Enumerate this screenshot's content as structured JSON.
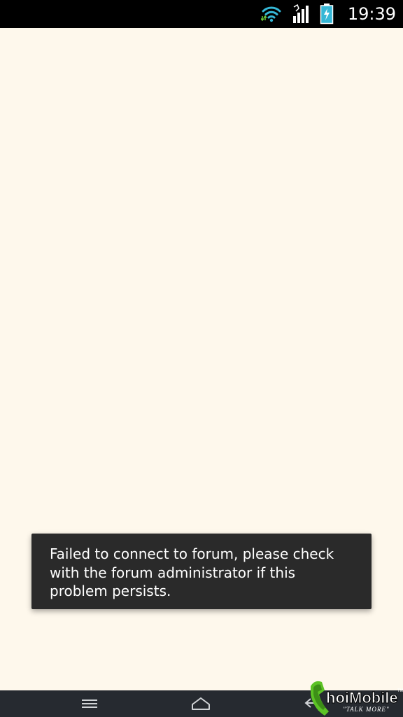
{
  "status_bar": {
    "time": "19:39",
    "icons": [
      "wifi-icon",
      "signal-icon",
      "battery-charging-icon"
    ],
    "colors": {
      "wifi": "#35b7d6",
      "battery": "#35b7d6",
      "background": "#000000"
    }
  },
  "screen": {
    "background": "#fef8ec"
  },
  "toast": {
    "message": "Failed to connect to forum, please check with the forum administrator if this problem persists.",
    "background": "#2a2a2a"
  },
  "nav_bar": {
    "buttons": [
      "menu-icon",
      "home-icon",
      "back-icon"
    ],
    "background": "#262a30"
  },
  "watermark": {
    "text": "ThoiMobile",
    "tagline": "\"TALK MORE\"",
    "trademark": "TM",
    "accent": "#5cc225"
  }
}
